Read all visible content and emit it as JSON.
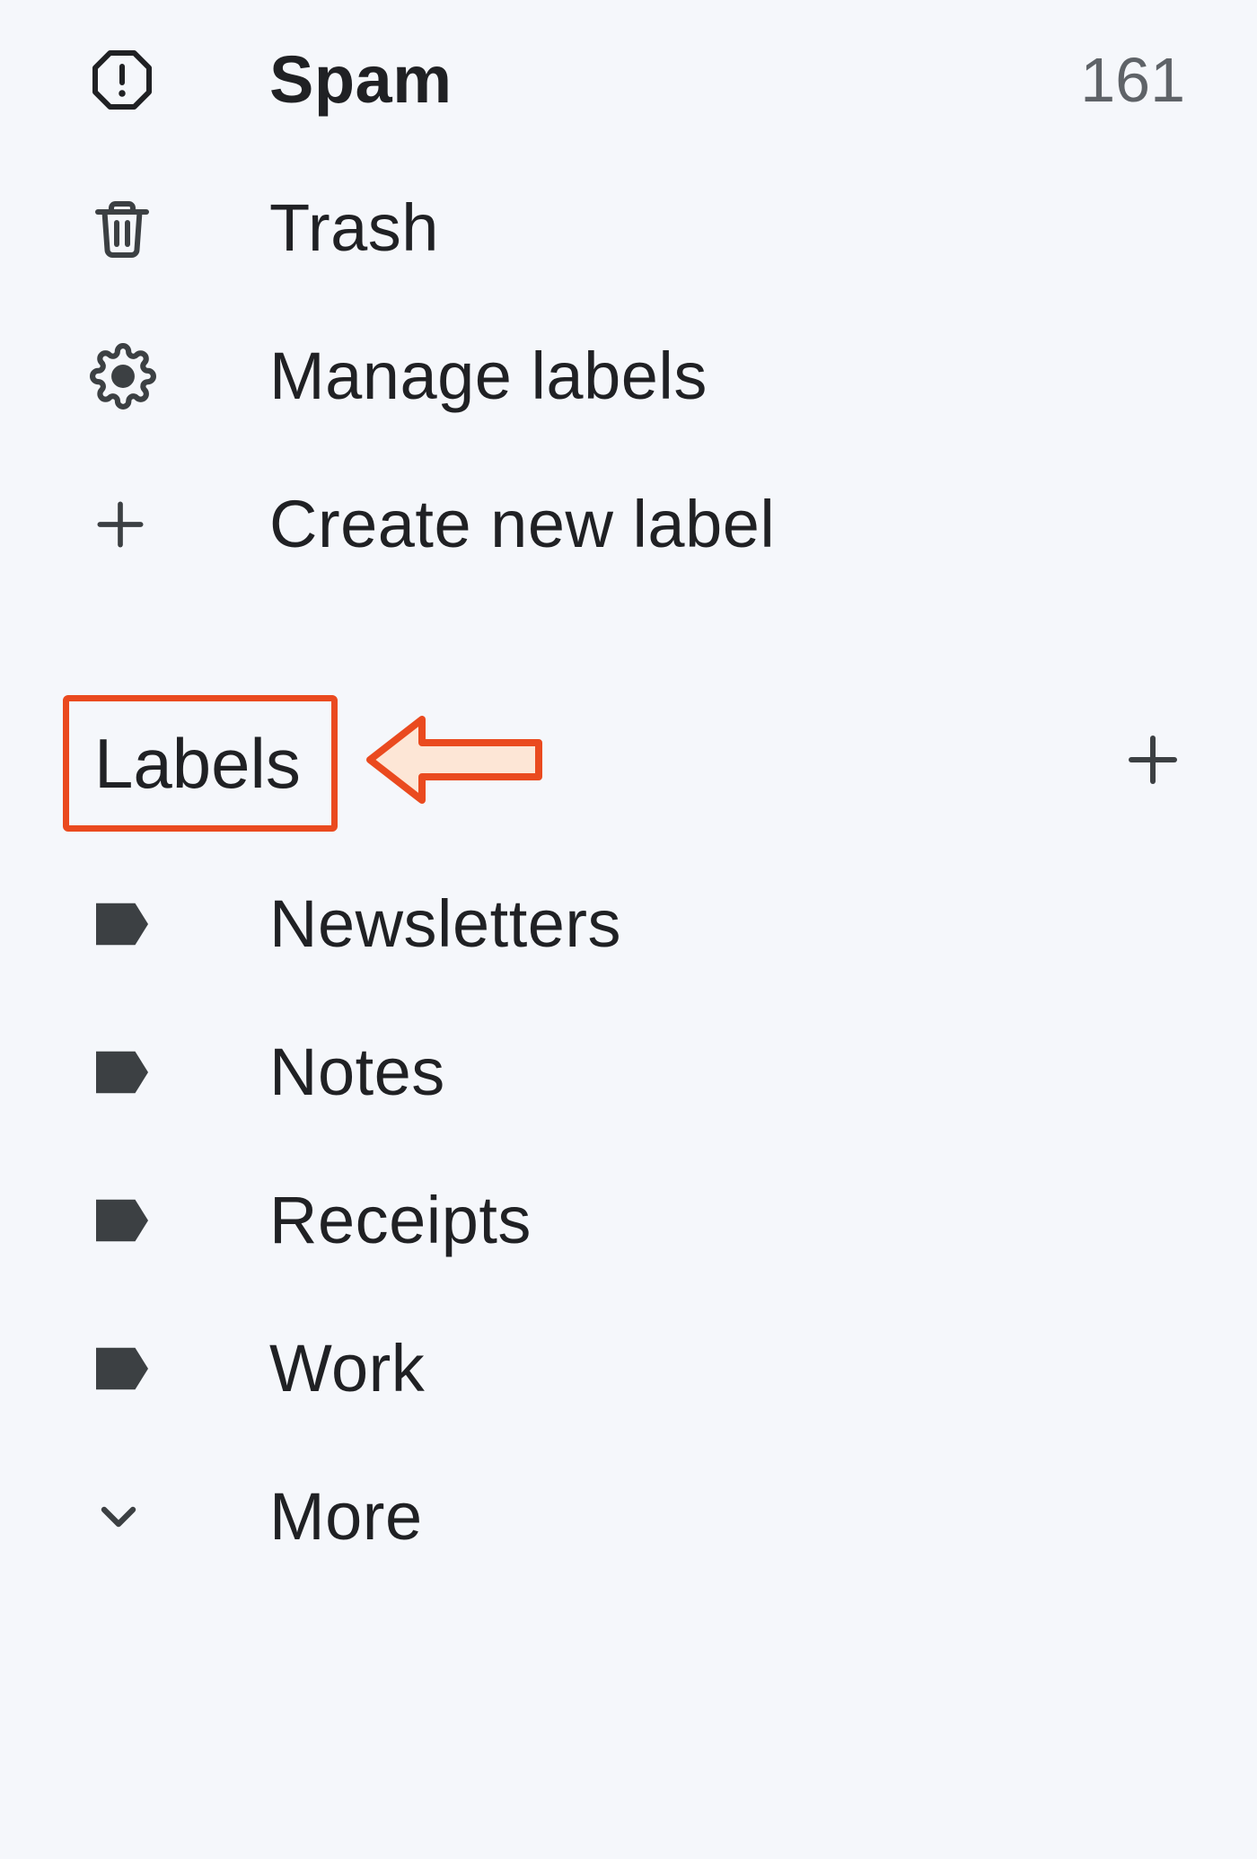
{
  "sidebar": {
    "spam": {
      "label": "Spam",
      "count": "161"
    },
    "trash": {
      "label": "Trash"
    },
    "manage": {
      "label": "Manage labels"
    },
    "create": {
      "label": "Create new label"
    }
  },
  "labels_section": {
    "title": "Labels",
    "items": [
      {
        "label": "Newsletters"
      },
      {
        "label": "Notes"
      },
      {
        "label": "Receipts"
      },
      {
        "label": "Work"
      }
    ],
    "more": "More"
  }
}
